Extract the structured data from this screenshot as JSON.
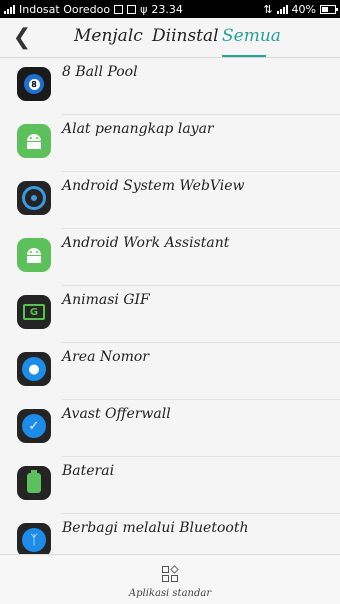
{
  "status_bar": {
    "carrier": "Indosat Ooredoo",
    "time": "23.34",
    "battery": "40%"
  },
  "header": {
    "back_icon": "back-arrow-icon",
    "tabs": [
      {
        "label": "Menjalc",
        "active": false
      },
      {
        "label": "Diinstal",
        "active": false
      },
      {
        "label": "Semua",
        "active": true
      }
    ],
    "accent_color": "#2aa197"
  },
  "apps": [
    {
      "name": "8 Ball Pool",
      "icon": "8-ball-pool-icon"
    },
    {
      "name": "Alat penangkap layar",
      "icon": "android-icon"
    },
    {
      "name": "Android System WebView",
      "icon": "webview-icon"
    },
    {
      "name": "Android Work Assistant",
      "icon": "android-icon"
    },
    {
      "name": "Animasi GIF",
      "icon": "gif-icon"
    },
    {
      "name": "Area Nomor",
      "icon": "location-icon"
    },
    {
      "name": "Avast Offerwall",
      "icon": "shield-icon"
    },
    {
      "name": "Baterai",
      "icon": "battery-icon"
    },
    {
      "name": "Berbagi melalui Bluetooth",
      "icon": "bluetooth-icon"
    }
  ],
  "bottom_bar": {
    "label": "Aplikasi standar",
    "icon": "default-apps-icon"
  }
}
